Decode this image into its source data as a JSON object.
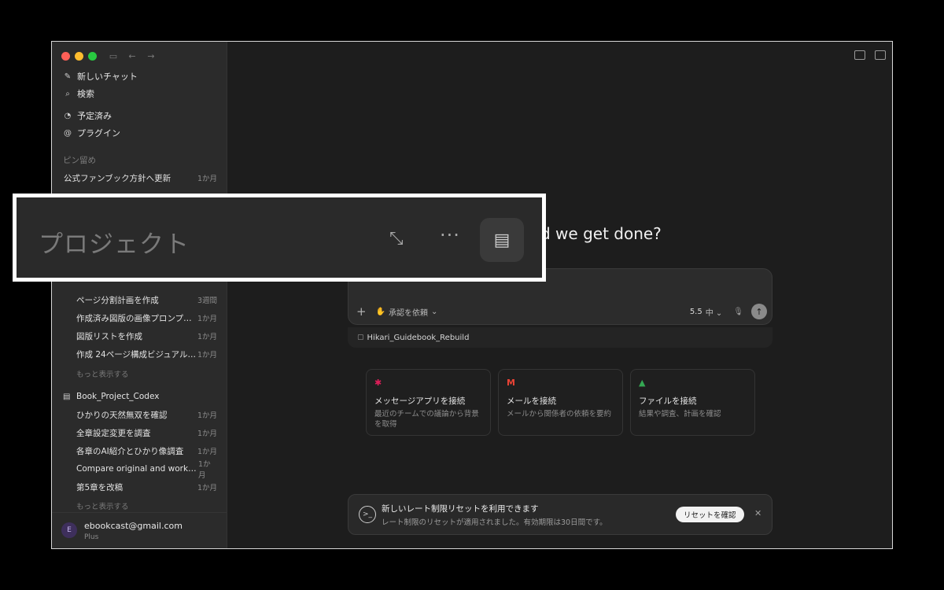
{
  "sidebar": {
    "top_items": [
      {
        "icon": "edit-icon",
        "glyph": "✎",
        "label": "新しいチャット"
      },
      {
        "icon": "search-icon",
        "glyph": "⌕",
        "label": "検索"
      }
    ],
    "mid_items": [
      {
        "icon": "clock-icon",
        "glyph": "◔",
        "label": "予定済み"
      },
      {
        "icon": "plugin-icon",
        "glyph": "@",
        "label": "プラグイン"
      }
    ],
    "pinned_label": "ピン留め",
    "pinned": [
      {
        "title": "公式ファンブック方針へ更新",
        "date": "1か月"
      }
    ],
    "project_chats": [
      {
        "title": "ページ分割計画を作成",
        "date": "3週間"
      },
      {
        "title": "作成済み図版の画像プロンプ…",
        "date": "1か月"
      },
      {
        "title": "図版リストを作成",
        "date": "1か月"
      },
      {
        "title": "作成 24ページ構成ビジュアル…",
        "date": "1か月"
      }
    ],
    "show_more": "もっと表示する",
    "project2": {
      "name": "Book_Project_Codex",
      "chats": [
        {
          "title": "ひかりの天然無双を確認",
          "date": "1か月"
        },
        {
          "title": "全章設定変更を調査",
          "date": "1か月"
        },
        {
          "title": "各章のAI紹介とひかり像調査",
          "date": "1か月"
        },
        {
          "title": "Compare original and workin…",
          "date": "1か月"
        },
        {
          "title": "第5章を改稿",
          "date": "1か月"
        }
      ],
      "show_more": "もっと表示する"
    },
    "account": {
      "initial": "E",
      "email": "ebookcast@gmail.com",
      "plan": "Plus"
    }
  },
  "main": {
    "headline": "d we get done?",
    "composer": {
      "approve_label": "承認を依頼",
      "model": "5.5",
      "effort": "中"
    },
    "attachment": "Hikari_Guidebook_Rebuild",
    "cards": [
      {
        "logo": "slack-icon",
        "glyph": "✱",
        "color": "#e01e5a",
        "title": "メッセージアプリを接続",
        "desc": "最近のチームでの議論から背景を取得"
      },
      {
        "logo": "gmail-icon",
        "glyph": "M",
        "color": "#ea4335",
        "title": "メールを接続",
        "desc": "メールから関係者の依頼を要約"
      },
      {
        "logo": "drive-icon",
        "glyph": "▲",
        "color": "#34a853",
        "title": "ファイルを接続",
        "desc": "結果や調査、計画を確認"
      }
    ],
    "toast": {
      "title": "新しいレート制限リセットを利用できます",
      "body": "レート制限のリセットが適用されました。有効期限は30日間です。",
      "button": "リセットを確認"
    }
  },
  "zoom": {
    "title": "プロジェクト"
  }
}
